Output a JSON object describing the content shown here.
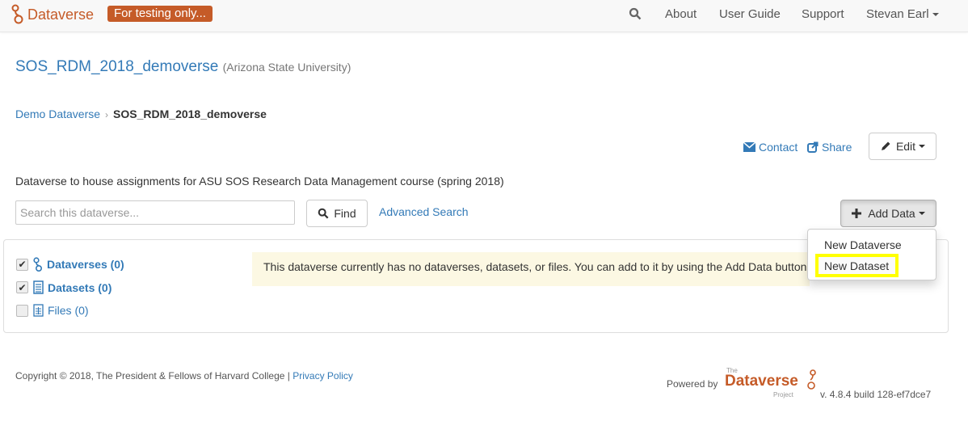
{
  "navbar": {
    "brand": "Dataverse",
    "badge": "For testing only...",
    "items": {
      "about": "About",
      "guide": "User Guide",
      "support": "Support",
      "user": "Stevan Earl"
    }
  },
  "dataverse": {
    "title": "SOS_RDM_2018_demoverse",
    "affiliation": "(Arizona State University)",
    "description": "Dataverse to house assignments for ASU SOS Research Data Management course (spring 2018)"
  },
  "breadcrumb": {
    "parent": "Demo Dataverse",
    "current": "SOS_RDM_2018_demoverse"
  },
  "actions": {
    "contact": "Contact",
    "share": "Share",
    "edit": "Edit"
  },
  "search": {
    "placeholder": "Search this dataverse...",
    "find_label": "Find",
    "advanced": "Advanced Search",
    "add_data": "Add Data"
  },
  "add_data_menu": {
    "new_dataverse": "New Dataverse",
    "new_dataset": "New Dataset"
  },
  "facets": [
    {
      "label": "Dataverses (0)",
      "checked": true
    },
    {
      "label": "Datasets (0)",
      "checked": true
    },
    {
      "label": "Files (0)",
      "checked": false
    }
  ],
  "empty_message": "This dataverse currently has no dataverses, datasets, or files. You can add to it by using the Add Data button on this page.",
  "footer": {
    "copyright": "Copyright © 2018, The President & Fellows of Harvard College |",
    "privacy": "Privacy Policy",
    "powered_by": "Powered by",
    "logo_the": "The",
    "logo_name": "Dataverse",
    "logo_project": "Project",
    "version": "v. 4.8.4 build 128-ef7dce7"
  },
  "colors": {
    "brand": "#c55b28",
    "link": "#337ab7",
    "highlight": "#ffff00",
    "alert_bg": "#fcf8e3"
  }
}
